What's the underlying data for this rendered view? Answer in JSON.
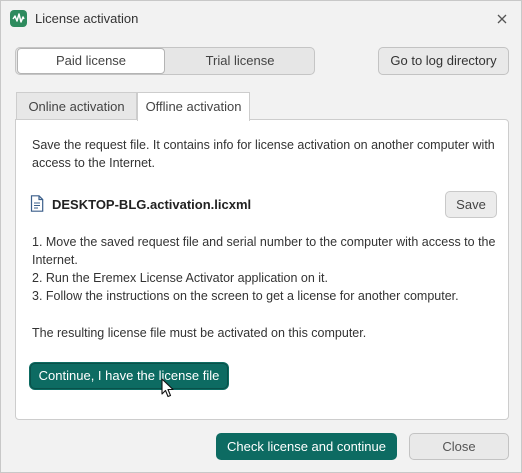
{
  "window": {
    "title": "License activation"
  },
  "license_type": {
    "options": [
      "Paid license",
      "Trial license"
    ],
    "selected": "Paid license"
  },
  "toolbar": {
    "log_button": "Go to log directory"
  },
  "tabs": [
    {
      "label": "Online activation",
      "active": false
    },
    {
      "label": "Offline activation",
      "active": true
    }
  ],
  "offline": {
    "intro": "Save the request file. It contains info for license activation on another computer with access to the Internet.",
    "file_name": "DESKTOP-BLG.activation.licxml",
    "save_label": "Save",
    "steps": [
      "1. Move the saved request file and serial number to the computer with access to the Internet.",
      "2. Run the Eremex License Activator application on it.",
      "3. Follow the instructions on the screen to get a license for another computer."
    ],
    "result_note": "The resulting license file must be activated on this computer.",
    "continue_label": "Continue, I have the license file"
  },
  "footer": {
    "check_label": "Check license and continue",
    "close_label": "Close"
  },
  "colors": {
    "accent": "#0d6b62",
    "app_icon": "#2e8b5e"
  },
  "icons": [
    "app-logo-icon",
    "close-icon",
    "file-icon",
    "mouse-cursor-icon"
  ]
}
